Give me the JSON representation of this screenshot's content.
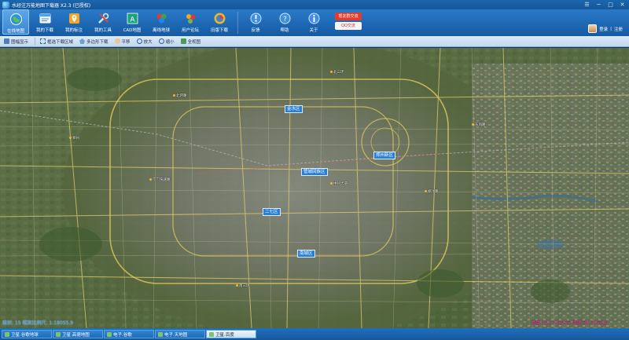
{
  "window": {
    "title": "水经注万能地图下载器 X2.3 (已授权)",
    "controls": {
      "menu": "☰",
      "minimize": "─",
      "maximize": "□",
      "close": "✕"
    }
  },
  "ribbon": {
    "items": [
      {
        "label": "在线地图",
        "icon": "globe-icon",
        "active": true
      },
      {
        "label": "我的下载",
        "icon": "download-list-icon"
      },
      {
        "label": "我的标注",
        "icon": "map-pin-icon"
      },
      {
        "label": "我的工具",
        "icon": "tools-icon"
      },
      {
        "label": "CAD地图",
        "icon": "cad-icon"
      },
      {
        "label": "离线地球",
        "icon": "offline-globe-icon"
      },
      {
        "label": "用户论坛",
        "icon": "forum-icon"
      },
      {
        "label": "旧版下载",
        "icon": "old-version-icon"
      },
      {
        "label": "反馈",
        "icon": "feedback-icon"
      },
      {
        "label": "帮助",
        "icon": "help-icon"
      },
      {
        "label": "关于",
        "icon": "about-icon"
      }
    ],
    "promo": {
      "badge": "帮友群交流",
      "qq": "QQ交流"
    },
    "user": {
      "name": "登录",
      "register": "注册"
    }
  },
  "tools": {
    "items": [
      {
        "label": "图幅显示",
        "icon": "grid-icon"
      },
      {
        "label": "框选下载区域",
        "icon": "select-region-icon"
      },
      {
        "label": "多边形下载",
        "icon": "polygon-icon"
      },
      {
        "label": "平移",
        "icon": "pan-icon"
      },
      {
        "label": "放大",
        "icon": "zoom-in-icon"
      },
      {
        "label": "缩小",
        "icon": "zoom-out-icon"
      },
      {
        "label": "全视图",
        "icon": "full-extent-icon"
      }
    ]
  },
  "map": {
    "districts": [
      "金水区",
      "郑州新区",
      "管城回族区",
      "二七区",
      "南城区"
    ],
    "labels": [
      "郑州",
      "北环路",
      "中州大道",
      "京广快速路",
      "郑汴路",
      "南三环",
      "北三环",
      "东风路"
    ],
    "scale_text": "级别: 15 缩放比例尺: 1:18055.9",
    "coord_text": "经度:113.714235 纬度:34.745921"
  },
  "tabs": [
    {
      "label": "卫星.谷歌地球",
      "active": false
    },
    {
      "label": "卫星.高德地图",
      "active": false
    },
    {
      "label": "电子.谷歌",
      "active": false
    },
    {
      "label": "电子.天地图",
      "active": false
    },
    {
      "label": "卫星.百度",
      "active": true
    }
  ]
}
